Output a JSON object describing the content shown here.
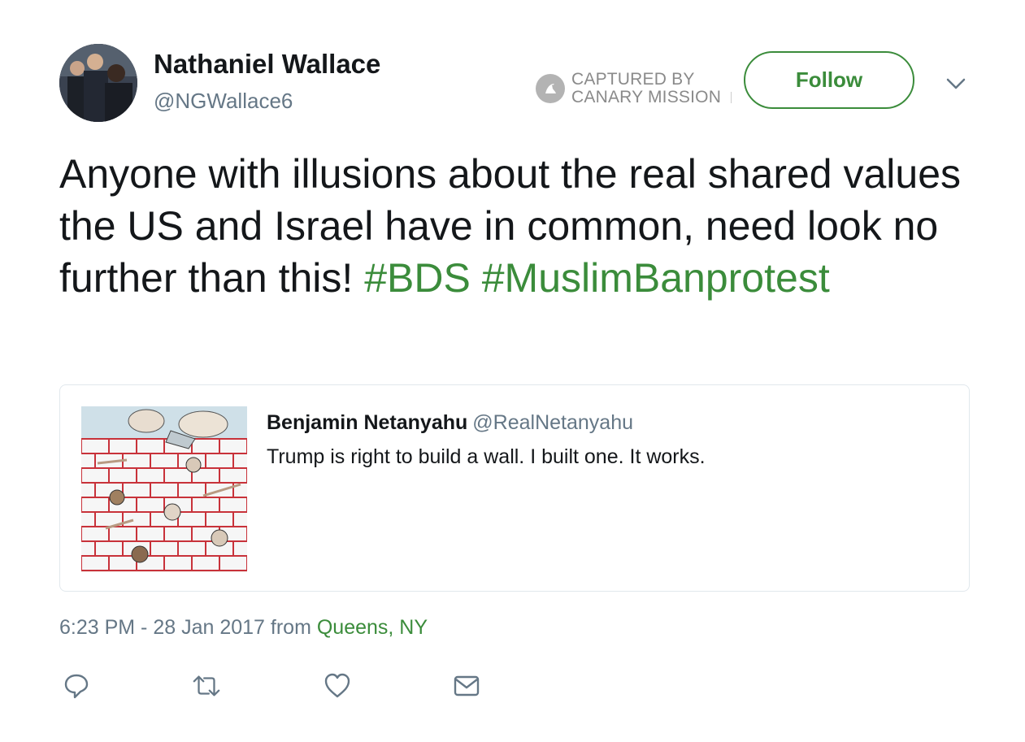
{
  "author": {
    "name": "Nathaniel Wallace",
    "handle": "@NGWallace6"
  },
  "watermark": {
    "line1": "CAPTURED BY",
    "line2": "CANARY MISSION"
  },
  "follow_button": {
    "label": "Follow"
  },
  "tweet": {
    "text": "Anyone with illusions about the real shared values the US and Israel have in common, need look no further than this!",
    "hashtags": [
      "#BDS",
      "#MuslimBanprotest"
    ]
  },
  "quoted_tweet": {
    "name": "Benjamin Netanyahu",
    "handle": "@RealNetanyahu",
    "text": "Trump is right to build a wall. I built one. It works."
  },
  "meta": {
    "timestamp": "6:23 PM - 28 Jan 2017",
    "from_label": "from",
    "location": "Queens, NY"
  },
  "icons": {
    "more": "chevron-down-icon",
    "reply": "reply-icon",
    "retweet": "retweet-icon",
    "like": "heart-icon",
    "message": "envelope-icon"
  },
  "colors": {
    "accent": "#3b8c3b",
    "secondary_text": "#657786",
    "primary_text": "#14171a",
    "border": "#e1e8ed"
  }
}
